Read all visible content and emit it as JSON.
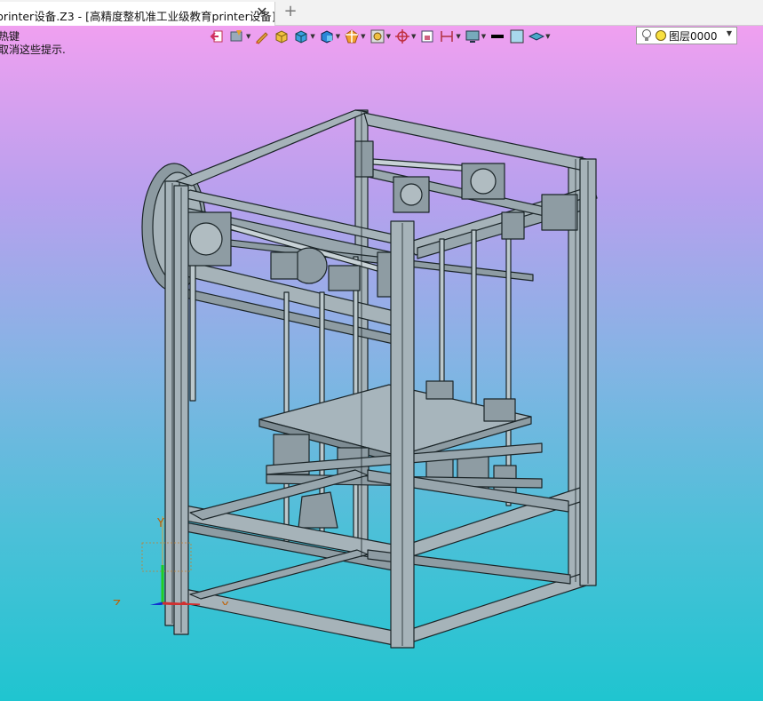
{
  "tab": {
    "title": "printer设备.Z3 - [高精度整机准工业级教育printer设备]",
    "close_glyph": "✕",
    "new_glyph": "+"
  },
  "viewport": {
    "hint_line1": "热键",
    "hint_line2": "取消这些提示."
  },
  "toolbar": {
    "icons": [
      "exit-icon",
      "filter-icon",
      "pen-icon",
      "solid-box-icon",
      "view-cube-icon",
      "render-cube-icon",
      "section-icon",
      "zoom-fit-icon",
      "crosshair-icon",
      "window-icon",
      "dimension-icon",
      "display-icon",
      "line-color-swatch",
      "fill-color-swatch",
      "surface-icon"
    ],
    "layer_value": "图层0000"
  },
  "triad": {
    "z_label": "Z",
    "x_label": "X",
    "y_label": "Y"
  },
  "colors": {
    "frame_fill": "#a6b3b9",
    "frame_edge": "#1b2528",
    "fill_swatch": "#a8d8ec"
  }
}
